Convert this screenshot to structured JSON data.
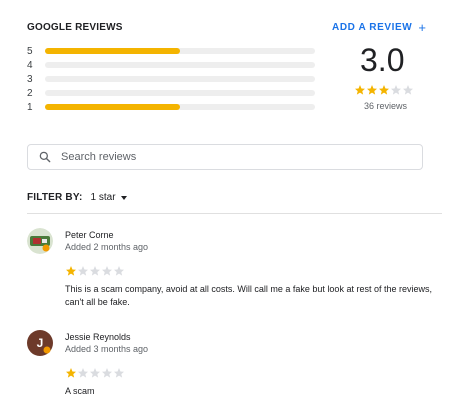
{
  "header": {
    "title": "GOOGLE REVIEWS",
    "add_review_label": "ADD A REVIEW",
    "add_review_icon": "+"
  },
  "distribution": [
    {
      "stars": "5",
      "fraction": 0.5
    },
    {
      "stars": "4",
      "fraction": 0
    },
    {
      "stars": "3",
      "fraction": 0
    },
    {
      "stars": "2",
      "fraction": 0
    },
    {
      "stars": "1",
      "fraction": 0.5
    }
  ],
  "summary": {
    "average": "3.0",
    "average_stars": 3,
    "review_count": "36 reviews"
  },
  "search": {
    "placeholder": "Search reviews",
    "value": ""
  },
  "filter": {
    "label": "FILTER BY:",
    "value": "1 star"
  },
  "reviews": [
    {
      "name": "Peter Corne",
      "date": "Added 2 months ago",
      "rating": 1,
      "text": "This is a scam company, avoid at all costs. Will call me a fake but look at rest of the reviews, can't all be fake.",
      "avatar_icon": "photo-avatar"
    },
    {
      "name": "Jessie Reynolds",
      "date": "Added 3 months ago",
      "rating": 1,
      "text": "A scam",
      "avatar_letter": "J"
    }
  ],
  "colors": {
    "accent": "#1a73e8",
    "star_filled": "#f4b400",
    "star_empty": "#dadce0",
    "avatar_brown": "#6d3a2a"
  }
}
